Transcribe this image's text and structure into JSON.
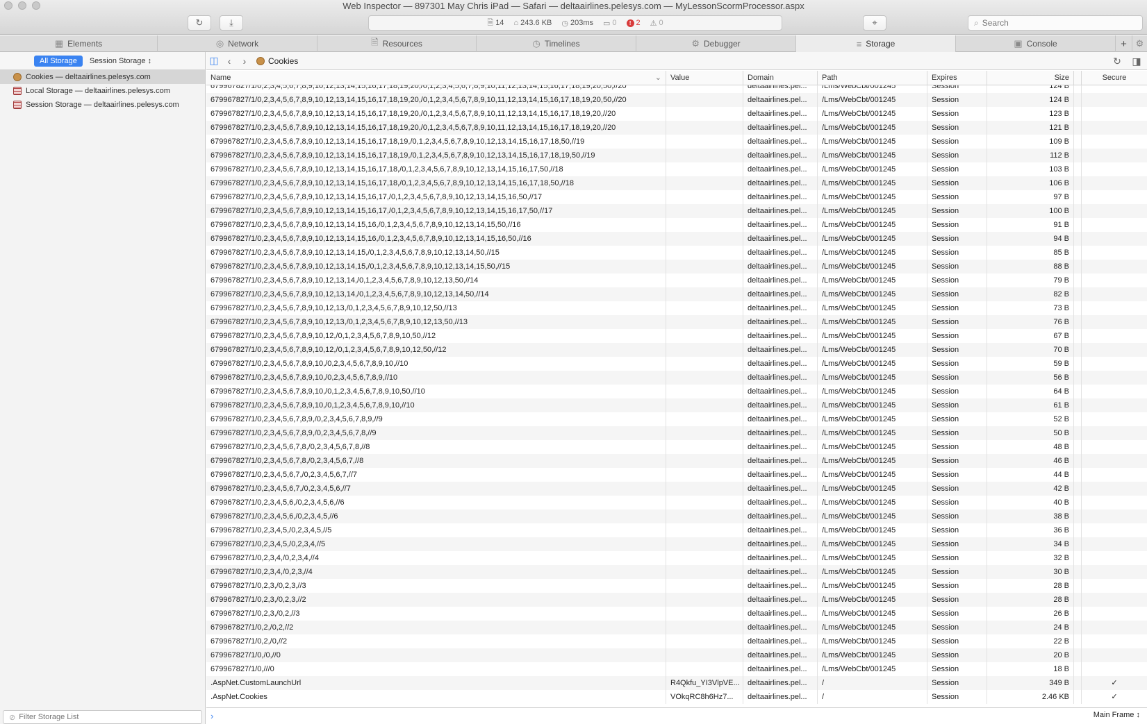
{
  "window": {
    "title": "Web Inspector — 897301 May Chris iPad  — Safari — deltaairlines.pelesys.com — MyLessonScormProcessor.aspx"
  },
  "activity": {
    "resources": "14",
    "size": "243.6 KB",
    "time": "203ms",
    "logs": "0",
    "errors": "2",
    "warnings": "0"
  },
  "search": {
    "placeholder": "Search",
    "value": ""
  },
  "tabs": [
    {
      "label": "Elements",
      "icon": "elements-icon"
    },
    {
      "label": "Network",
      "icon": "network-icon"
    },
    {
      "label": "Resources",
      "icon": "resources-icon"
    },
    {
      "label": "Timelines",
      "icon": "timelines-icon"
    },
    {
      "label": "Debugger",
      "icon": "debugger-icon"
    },
    {
      "label": "Storage",
      "icon": "storage-icon",
      "active": true
    },
    {
      "label": "Console",
      "icon": "console-icon"
    }
  ],
  "sidebar": {
    "scope_all": "All Storage",
    "scope_session": "Session Storage",
    "items": [
      {
        "label": "Cookies — deltaairlines.pelesys.com",
        "icon": "cookie-icon",
        "selected": true
      },
      {
        "label": "Local Storage — deltaairlines.pelesys.com",
        "icon": "storage-table-icon"
      },
      {
        "label": "Session Storage — deltaairlines.pelesys.com",
        "icon": "storage-table-icon"
      }
    ],
    "filter_placeholder": "Filter Storage List"
  },
  "content": {
    "title": "Cookies",
    "columns": [
      "Name",
      "Value",
      "Domain",
      "Path",
      "Expires",
      "Size",
      "",
      "Secure"
    ],
    "rows": [
      [
        "679967827/1/0,2,3,4,5,6,7,8,9,10,12,13,14,15,16,17,18,19,20,/0,1,2,3,4,5,6,7,8,9,10,11,12,13,14,15,16,17,18,19,20,50,//20",
        "",
        "deltaairlines.pel...",
        "/Lms/WebCbt/001245",
        "Session",
        "124 B",
        "",
        ""
      ],
      [
        "679967827/1/0,2,3,4,5,6,7,8,9,10,12,13,14,15,16,17,18,19,20,/0,1,2,3,4,5,6,7,8,9,10,11,12,13,14,15,16,17,18,19,20,50,//20",
        "",
        "deltaairlines.pel...",
        "/Lms/WebCbt/001245",
        "Session",
        "124 B",
        "",
        ""
      ],
      [
        "679967827/1/0,2,3,4,5,6,7,8,9,10,12,13,14,15,16,17,18,19,20,/0,1,2,3,4,5,6,7,8,9,10,11,12,13,14,15,16,17,18,19,20,//20",
        "",
        "deltaairlines.pel...",
        "/Lms/WebCbt/001245",
        "Session",
        "123 B",
        "",
        ""
      ],
      [
        "679967827/1/0,2,3,4,5,6,7,8,9,10,12,13,14,15,16,17,18,19,20,/0,1,2,3,4,5,6,7,8,9,10,11,12,13,14,15,16,17,18,19,20,//20",
        "",
        "deltaairlines.pel...",
        "/Lms/WebCbt/001245",
        "Session",
        "121 B",
        "",
        ""
      ],
      [
        "679967827/1/0,2,3,4,5,6,7,8,9,10,12,13,14,15,16,17,18,19,/0,1,2,3,4,5,6,7,8,9,10,12,13,14,15,16,17,18,50,//19",
        "",
        "deltaairlines.pel...",
        "/Lms/WebCbt/001245",
        "Session",
        "109 B",
        "",
        ""
      ],
      [
        "679967827/1/0,2,3,4,5,6,7,8,9,10,12,13,14,15,16,17,18,19,/0,1,2,3,4,5,6,7,8,9,10,12,13,14,15,16,17,18,19,50,//19",
        "",
        "deltaairlines.pel...",
        "/Lms/WebCbt/001245",
        "Session",
        "112 B",
        "",
        ""
      ],
      [
        "679967827/1/0,2,3,4,5,6,7,8,9,10,12,13,14,15,16,17,18,/0,1,2,3,4,5,6,7,8,9,10,12,13,14,15,16,17,50,//18",
        "",
        "deltaairlines.pel...",
        "/Lms/WebCbt/001245",
        "Session",
        "103 B",
        "",
        ""
      ],
      [
        "679967827/1/0,2,3,4,5,6,7,8,9,10,12,13,14,15,16,17,18,/0,1,2,3,4,5,6,7,8,9,10,12,13,14,15,16,17,18,50,//18",
        "",
        "deltaairlines.pel...",
        "/Lms/WebCbt/001245",
        "Session",
        "106 B",
        "",
        ""
      ],
      [
        "679967827/1/0,2,3,4,5,6,7,8,9,10,12,13,14,15,16,17,/0,1,2,3,4,5,6,7,8,9,10,12,13,14,15,16,50,//17",
        "",
        "deltaairlines.pel...",
        "/Lms/WebCbt/001245",
        "Session",
        "97 B",
        "",
        ""
      ],
      [
        "679967827/1/0,2,3,4,5,6,7,8,9,10,12,13,14,15,16,17,/0,1,2,3,4,5,6,7,8,9,10,12,13,14,15,16,17,50,//17",
        "",
        "deltaairlines.pel...",
        "/Lms/WebCbt/001245",
        "Session",
        "100 B",
        "",
        ""
      ],
      [
        "679967827/1/0,2,3,4,5,6,7,8,9,10,12,13,14,15,16,/0,1,2,3,4,5,6,7,8,9,10,12,13,14,15,50,//16",
        "",
        "deltaairlines.pel...",
        "/Lms/WebCbt/001245",
        "Session",
        "91 B",
        "",
        ""
      ],
      [
        "679967827/1/0,2,3,4,5,6,7,8,9,10,12,13,14,15,16,/0,1,2,3,4,5,6,7,8,9,10,12,13,14,15,16,50,//16",
        "",
        "deltaairlines.pel...",
        "/Lms/WebCbt/001245",
        "Session",
        "94 B",
        "",
        ""
      ],
      [
        "679967827/1/0,2,3,4,5,6,7,8,9,10,12,13,14,15,/0,1,2,3,4,5,6,7,8,9,10,12,13,14,50,//15",
        "",
        "deltaairlines.pel...",
        "/Lms/WebCbt/001245",
        "Session",
        "85 B",
        "",
        ""
      ],
      [
        "679967827/1/0,2,3,4,5,6,7,8,9,10,12,13,14,15,/0,1,2,3,4,5,6,7,8,9,10,12,13,14,15,50,//15",
        "",
        "deltaairlines.pel...",
        "/Lms/WebCbt/001245",
        "Session",
        "88 B",
        "",
        ""
      ],
      [
        "679967827/1/0,2,3,4,5,6,7,8,9,10,12,13,14,/0,1,2,3,4,5,6,7,8,9,10,12,13,50,//14",
        "",
        "deltaairlines.pel...",
        "/Lms/WebCbt/001245",
        "Session",
        "79 B",
        "",
        ""
      ],
      [
        "679967827/1/0,2,3,4,5,6,7,8,9,10,12,13,14,/0,1,2,3,4,5,6,7,8,9,10,12,13,14,50,//14",
        "",
        "deltaairlines.pel...",
        "/Lms/WebCbt/001245",
        "Session",
        "82 B",
        "",
        ""
      ],
      [
        "679967827/1/0,2,3,4,5,6,7,8,9,10,12,13,/0,1,2,3,4,5,6,7,8,9,10,12,50,//13",
        "",
        "deltaairlines.pel...",
        "/Lms/WebCbt/001245",
        "Session",
        "73 B",
        "",
        ""
      ],
      [
        "679967827/1/0,2,3,4,5,6,7,8,9,10,12,13,/0,1,2,3,4,5,6,7,8,9,10,12,13,50,//13",
        "",
        "deltaairlines.pel...",
        "/Lms/WebCbt/001245",
        "Session",
        "76 B",
        "",
        ""
      ],
      [
        "679967827/1/0,2,3,4,5,6,7,8,9,10,12,/0,1,2,3,4,5,6,7,8,9,10,50,//12",
        "",
        "deltaairlines.pel...",
        "/Lms/WebCbt/001245",
        "Session",
        "67 B",
        "",
        ""
      ],
      [
        "679967827/1/0,2,3,4,5,6,7,8,9,10,12,/0,1,2,3,4,5,6,7,8,9,10,12,50,//12",
        "",
        "deltaairlines.pel...",
        "/Lms/WebCbt/001245",
        "Session",
        "70 B",
        "",
        ""
      ],
      [
        "679967827/1/0,2,3,4,5,6,7,8,9,10,/0,2,3,4,5,6,7,8,9,10,//10",
        "",
        "deltaairlines.pel...",
        "/Lms/WebCbt/001245",
        "Session",
        "59 B",
        "",
        ""
      ],
      [
        "679967827/1/0,2,3,4,5,6,7,8,9,10,/0,2,3,4,5,6,7,8,9,//10",
        "",
        "deltaairlines.pel...",
        "/Lms/WebCbt/001245",
        "Session",
        "56 B",
        "",
        ""
      ],
      [
        "679967827/1/0,2,3,4,5,6,7,8,9,10,/0,1,2,3,4,5,6,7,8,9,10,50,//10",
        "",
        "deltaairlines.pel...",
        "/Lms/WebCbt/001245",
        "Session",
        "64 B",
        "",
        ""
      ],
      [
        "679967827/1/0,2,3,4,5,6,7,8,9,10,/0,1,2,3,4,5,6,7,8,9,10,//10",
        "",
        "deltaairlines.pel...",
        "/Lms/WebCbt/001245",
        "Session",
        "61 B",
        "",
        ""
      ],
      [
        "679967827/1/0,2,3,4,5,6,7,8,9,/0,2,3,4,5,6,7,8,9,//9",
        "",
        "deltaairlines.pel...",
        "/Lms/WebCbt/001245",
        "Session",
        "52 B",
        "",
        ""
      ],
      [
        "679967827/1/0,2,3,4,5,6,7,8,9,/0,2,3,4,5,6,7,8,//9",
        "",
        "deltaairlines.pel...",
        "/Lms/WebCbt/001245",
        "Session",
        "50 B",
        "",
        ""
      ],
      [
        "679967827/1/0,2,3,4,5,6,7,8,/0,2,3,4,5,6,7,8,//8",
        "",
        "deltaairlines.pel...",
        "/Lms/WebCbt/001245",
        "Session",
        "48 B",
        "",
        ""
      ],
      [
        "679967827/1/0,2,3,4,5,6,7,8,/0,2,3,4,5,6,7,//8",
        "",
        "deltaairlines.pel...",
        "/Lms/WebCbt/001245",
        "Session",
        "46 B",
        "",
        ""
      ],
      [
        "679967827/1/0,2,3,4,5,6,7,/0,2,3,4,5,6,7,//7",
        "",
        "deltaairlines.pel...",
        "/Lms/WebCbt/001245",
        "Session",
        "44 B",
        "",
        ""
      ],
      [
        "679967827/1/0,2,3,4,5,6,7,/0,2,3,4,5,6,//7",
        "",
        "deltaairlines.pel...",
        "/Lms/WebCbt/001245",
        "Session",
        "42 B",
        "",
        ""
      ],
      [
        "679967827/1/0,2,3,4,5,6,/0,2,3,4,5,6,//6",
        "",
        "deltaairlines.pel...",
        "/Lms/WebCbt/001245",
        "Session",
        "40 B",
        "",
        ""
      ],
      [
        "679967827/1/0,2,3,4,5,6,/0,2,3,4,5,//6",
        "",
        "deltaairlines.pel...",
        "/Lms/WebCbt/001245",
        "Session",
        "38 B",
        "",
        ""
      ],
      [
        "679967827/1/0,2,3,4,5,/0,2,3,4,5,//5",
        "",
        "deltaairlines.pel...",
        "/Lms/WebCbt/001245",
        "Session",
        "36 B",
        "",
        ""
      ],
      [
        "679967827/1/0,2,3,4,5,/0,2,3,4,//5",
        "",
        "deltaairlines.pel...",
        "/Lms/WebCbt/001245",
        "Session",
        "34 B",
        "",
        ""
      ],
      [
        "679967827/1/0,2,3,4,/0,2,3,4,//4",
        "",
        "deltaairlines.pel...",
        "/Lms/WebCbt/001245",
        "Session",
        "32 B",
        "",
        ""
      ],
      [
        "679967827/1/0,2,3,4,/0,2,3,//4",
        "",
        "deltaairlines.pel...",
        "/Lms/WebCbt/001245",
        "Session",
        "30 B",
        "",
        ""
      ],
      [
        "679967827/1/0,2,3,/0,2,3,//3",
        "",
        "deltaairlines.pel...",
        "/Lms/WebCbt/001245",
        "Session",
        "28 B",
        "",
        ""
      ],
      [
        "679967827/1/0,2,3,/0,2,3,//2",
        "",
        "deltaairlines.pel...",
        "/Lms/WebCbt/001245",
        "Session",
        "28 B",
        "",
        ""
      ],
      [
        "679967827/1/0,2,3,/0,2,//3",
        "",
        "deltaairlines.pel...",
        "/Lms/WebCbt/001245",
        "Session",
        "26 B",
        "",
        ""
      ],
      [
        "679967827/1/0,2,/0,2,//2",
        "",
        "deltaairlines.pel...",
        "/Lms/WebCbt/001245",
        "Session",
        "24 B",
        "",
        ""
      ],
      [
        "679967827/1/0,2,/0,//2",
        "",
        "deltaairlines.pel...",
        "/Lms/WebCbt/001245",
        "Session",
        "22 B",
        "",
        ""
      ],
      [
        "679967827/1/0,/0,//0",
        "",
        "deltaairlines.pel...",
        "/Lms/WebCbt/001245",
        "Session",
        "20 B",
        "",
        ""
      ],
      [
        "679967827/1/0,///0",
        "",
        "deltaairlines.pel...",
        "/Lms/WebCbt/001245",
        "Session",
        "18 B",
        "",
        ""
      ],
      [
        ".AspNet.CustomLaunchUrl",
        "R4Qkfu_YI3VlpVE...",
        "deltaairlines.pel...",
        "/",
        "Session",
        "349 B",
        "",
        "✓"
      ],
      [
        ".AspNet.Cookies",
        "VOkqRC8h6Hz7...",
        "deltaairlines.pel...",
        "/",
        "Session",
        "2.46 KB",
        "",
        "✓"
      ]
    ],
    "frame_selector": "Main Frame"
  },
  "colors": {
    "accent": "#3a83f1",
    "error": "#d83b3b"
  }
}
